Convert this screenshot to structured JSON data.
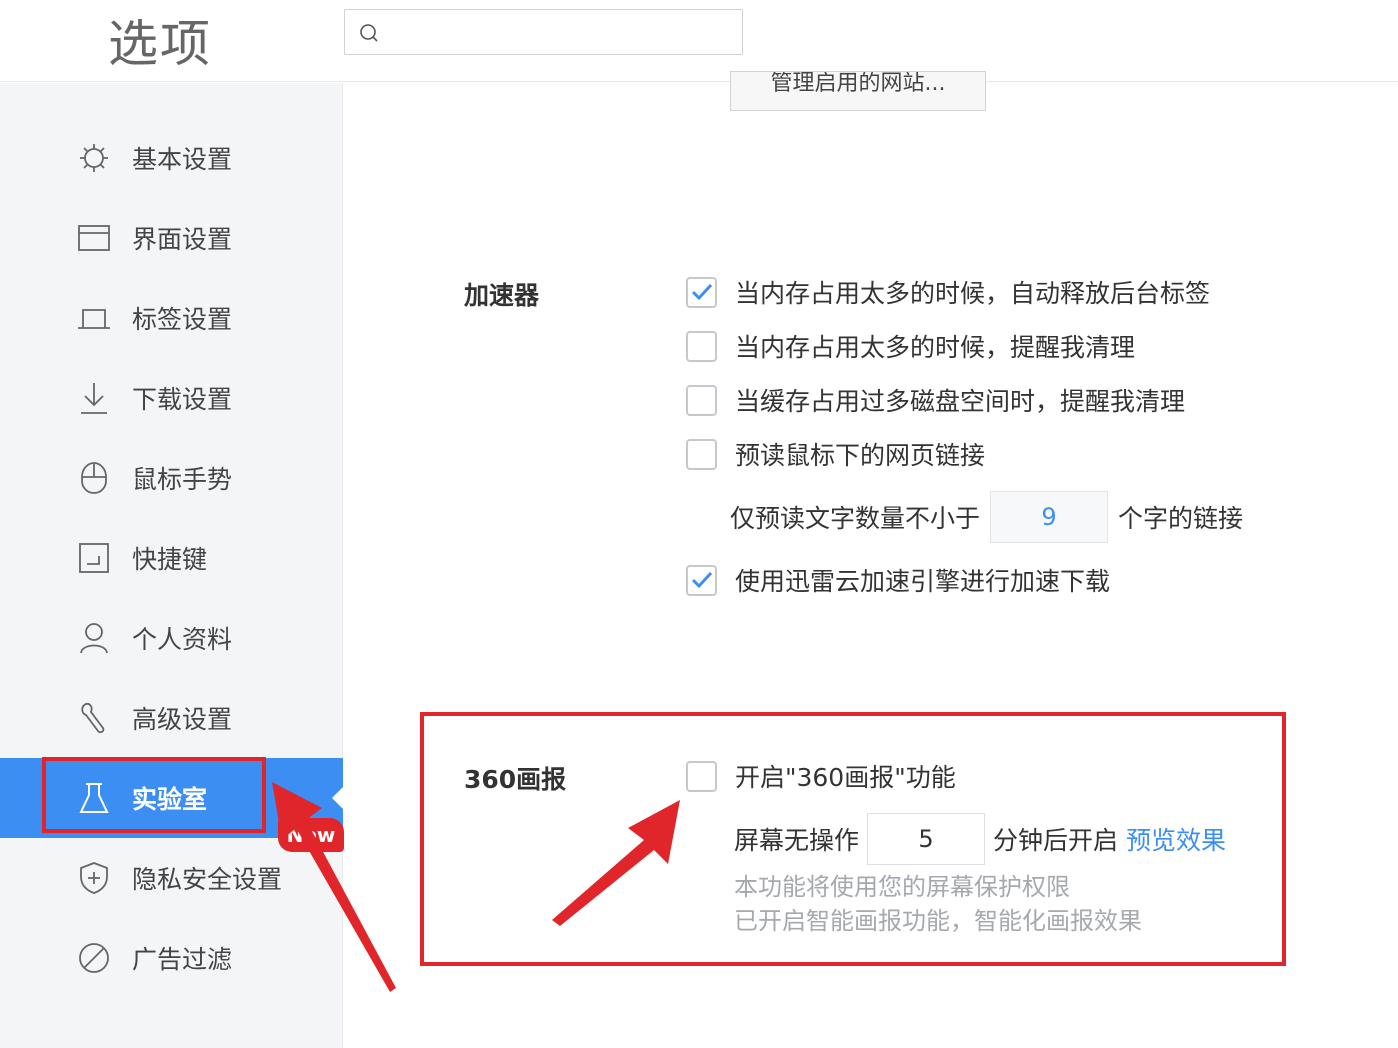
{
  "header": {
    "title": "选项",
    "search_placeholder": ""
  },
  "sidebar": {
    "items": [
      {
        "label": "基本设置",
        "icon": "gear-icon"
      },
      {
        "label": "界面设置",
        "icon": "window-icon"
      },
      {
        "label": "标签设置",
        "icon": "tab-icon"
      },
      {
        "label": "下载设置",
        "icon": "download-icon"
      },
      {
        "label": "鼠标手势",
        "icon": "mouse-icon"
      },
      {
        "label": "快捷键",
        "icon": "shortcut-icon"
      },
      {
        "label": "个人资料",
        "icon": "user-icon"
      },
      {
        "label": "高级设置",
        "icon": "wrench-icon"
      },
      {
        "label": "实验室",
        "icon": "flask-icon",
        "active": true
      },
      {
        "label": "隐私安全设置",
        "icon": "shield-icon"
      },
      {
        "label": "广告过滤",
        "icon": "block-icon"
      }
    ],
    "new_badge": "New"
  },
  "main": {
    "manage_button": "管理启用的网站...",
    "accelerator": {
      "title": "加速器",
      "options": [
        {
          "label": "当内存占用太多的时候，自动释放后台标签",
          "checked": true
        },
        {
          "label": "当内存占用太多的时候，提醒我清理",
          "checked": false
        },
        {
          "label": "当缓存占用过多磁盘空间时，提醒我清理",
          "checked": false
        },
        {
          "label": "预读鼠标下的网页链接",
          "checked": false
        }
      ],
      "preread_prefix": "仅预读文字数量不小于",
      "preread_value": "9",
      "preread_suffix": "个字的链接",
      "xunlei": {
        "label": "使用迅雷云加速引擎进行加速下载",
        "checked": true
      }
    },
    "huabao": {
      "title": "360画报",
      "enable": {
        "label": "开启\"360画报\"功能",
        "checked": false
      },
      "idle_prefix": "屏幕无操作",
      "idle_value": "5",
      "idle_suffix": "分钟后开启",
      "preview_link": "预览效果",
      "hint1": "本功能将使用您的屏幕保护权限",
      "hint2": "已开启智能画报功能，智能化画报效果"
    }
  },
  "colors": {
    "accent": "#3d8ef3",
    "highlight_red": "#e0262b",
    "sidebar_bg": "#f4f5f7"
  }
}
